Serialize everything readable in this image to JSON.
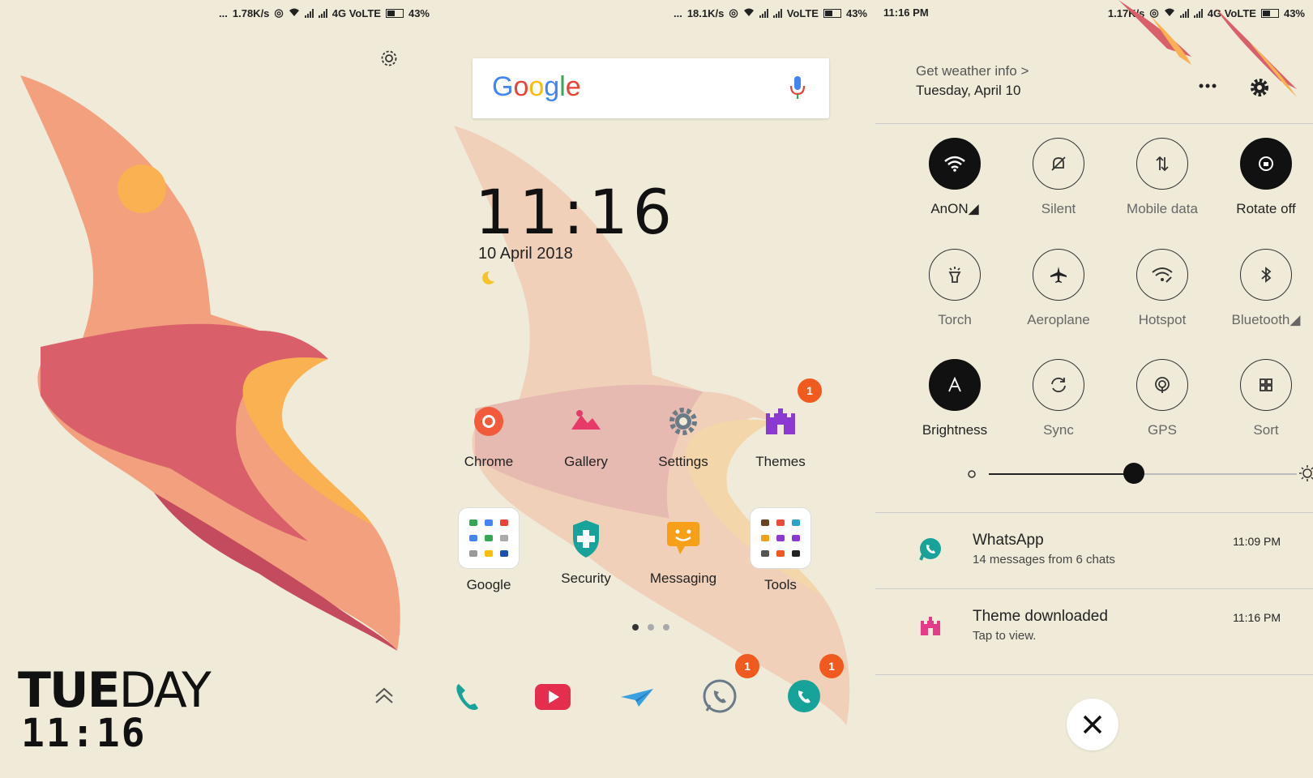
{
  "panel1": {
    "status": {
      "speed": "1.78K/s",
      "network": "4G VoLTE",
      "battery": "43%"
    },
    "day_bold": "TUE",
    "day_light": "DAY",
    "time": "11:16"
  },
  "panel2": {
    "status": {
      "speed": "18.1K/s",
      "network": "VoLTE",
      "battery": "43%"
    },
    "search": {
      "logo_letters": [
        "G",
        "o",
        "o",
        "g",
        "l",
        "e"
      ]
    },
    "clock": "11:16",
    "date": "10 April 2018",
    "apps_row1": [
      {
        "label": "Chrome"
      },
      {
        "label": "Gallery"
      },
      {
        "label": "Settings"
      },
      {
        "label": "Themes",
        "badge": "1"
      }
    ],
    "apps_row2": [
      {
        "label": "Google"
      },
      {
        "label": "Security"
      },
      {
        "label": "Messaging"
      },
      {
        "label": "Tools"
      }
    ],
    "dock_badges": {
      "whatsapp_outline": "1",
      "whatsapp": "1"
    }
  },
  "panel3": {
    "status": {
      "time": "11:16 PM",
      "speed": "1.17K/s",
      "network": "4G VoLTE",
      "battery": "43%"
    },
    "weather": "Get weather info >",
    "date": "Tuesday, April 10",
    "tiles": [
      {
        "label": "AnON",
        "on": true
      },
      {
        "label": "Silent",
        "on": false
      },
      {
        "label": "Mobile data",
        "on": false
      },
      {
        "label": "Rotate off",
        "on": true
      },
      {
        "label": "Torch",
        "on": false
      },
      {
        "label": "Aeroplane",
        "on": false
      },
      {
        "label": "Hotspot",
        "on": false
      },
      {
        "label": "Bluetooth",
        "on": false
      },
      {
        "label": "Brightness",
        "on": true
      },
      {
        "label": "Sync",
        "on": false
      },
      {
        "label": "GPS",
        "on": false
      },
      {
        "label": "Sort",
        "on": false
      }
    ],
    "brightness_level": 0.47,
    "notifications": [
      {
        "title": "WhatsApp",
        "sub": "14 messages from 6 chats",
        "time": "11:09 PM"
      },
      {
        "title": "Theme downloaded",
        "sub": "Tap to view.",
        "time": "11:16 PM"
      }
    ]
  },
  "colors": {
    "background": "#f0ebd9",
    "bird_light": "#f2a07e",
    "bird_mid": "#d9606a",
    "bird_dark": "#c44b5e",
    "bird_yellow": "#f9b151",
    "badge": "#f15a1e"
  }
}
